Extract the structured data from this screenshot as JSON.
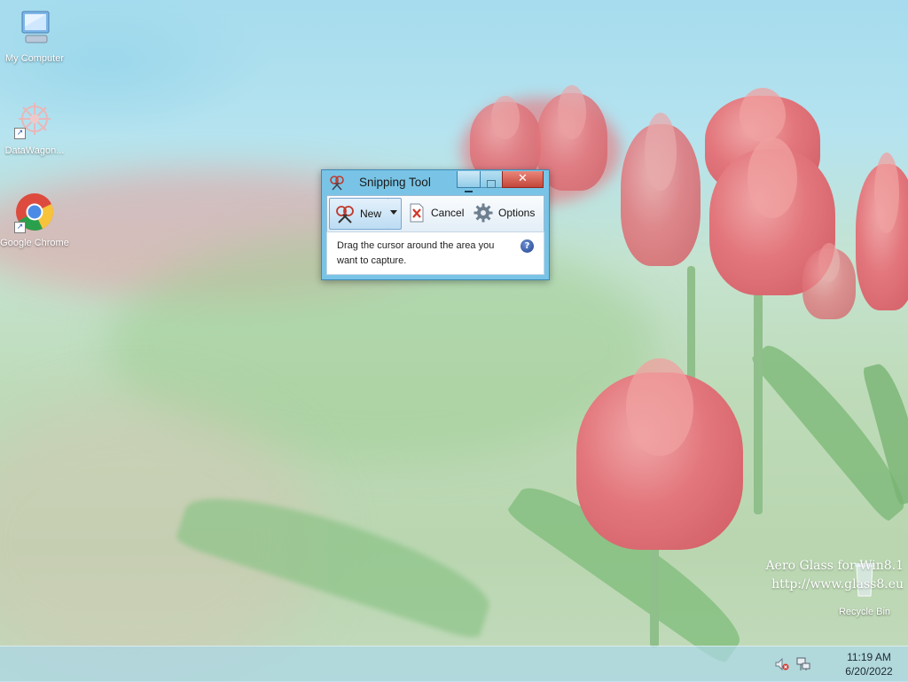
{
  "desktop": {
    "icons": [
      {
        "label": "My Computer"
      },
      {
        "label": "DataWagon..."
      },
      {
        "label": "Google Chrome"
      },
      {
        "label": "Recycle Bin"
      }
    ],
    "watermark": {
      "line1": "Aero Glass for Win8.1",
      "line2": "http://www.glass8.eu"
    }
  },
  "snipping_tool": {
    "title": "Snipping Tool",
    "toolbar": {
      "new_label": "New",
      "cancel_label": "Cancel",
      "options_label": "Options"
    },
    "message": "Drag the cursor around the area you want to capture.",
    "help_glyph": "?"
  },
  "taskbar": {
    "clock": {
      "time": "11:19 AM",
      "date": "6/20/2022"
    }
  },
  "colors": {
    "close_button": "#c4463a",
    "window_frame": "#79c4e6",
    "taskbar": "#aad7e8"
  }
}
